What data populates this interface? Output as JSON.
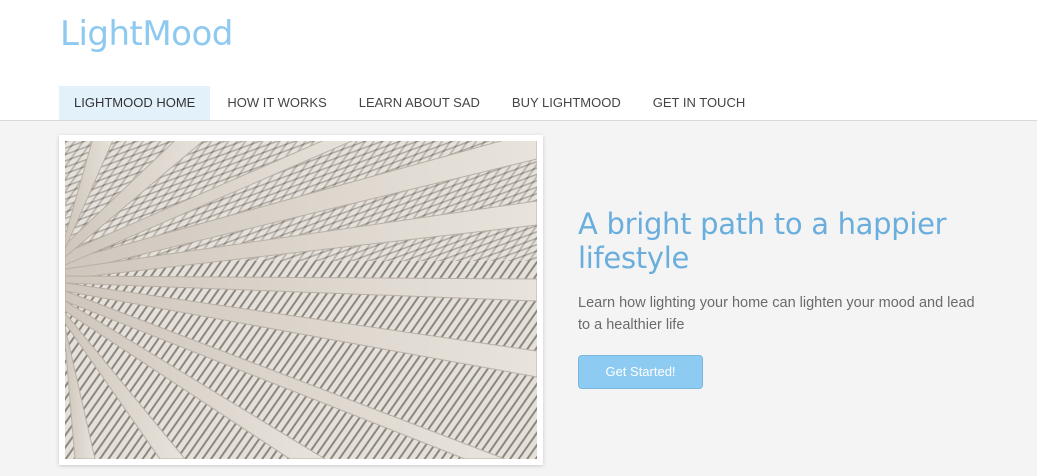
{
  "site": {
    "logo": "LightMood"
  },
  "nav": {
    "items": [
      {
        "label": "LIGHTMOOD HOME",
        "active": true
      },
      {
        "label": "HOW IT WORKS",
        "active": false
      },
      {
        "label": "LEARN ABOUT SAD",
        "active": false
      },
      {
        "label": "BUY LIGHTMOOD",
        "active": false
      },
      {
        "label": "GET IN TOUCH",
        "active": false
      }
    ]
  },
  "hero": {
    "headline": "A bright path to a happier lifestyle",
    "subtext": "Learn how lighting your home can lighten your mood and lead to a healthier life",
    "cta_label": "Get Started!"
  },
  "colors": {
    "logo": "#8ec9f0",
    "headline": "#6aaedd",
    "nav_active_bg": "#e3f1fb",
    "button_bg": "#8ecbf2"
  }
}
